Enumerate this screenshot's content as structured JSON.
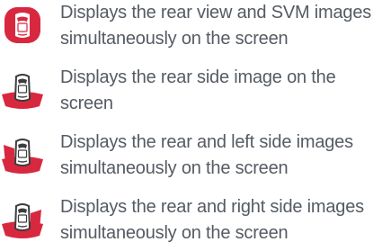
{
  "accent_color": "#d8283f",
  "text_color": "#555b63",
  "view_modes": [
    {
      "icon": "rear-view-svm-icon",
      "description": "Displays the rear view and SVM images simultaneously on the screen"
    },
    {
      "icon": "rear-side-view-icon",
      "description": "Displays the rear side image on the screen"
    },
    {
      "icon": "rear-left-side-view-icon",
      "description": "Displays the rear and left side images simultaneously on the screen"
    },
    {
      "icon": "rear-right-side-view-icon",
      "description": "Displays the rear and right side images simultaneously on the screen"
    }
  ]
}
